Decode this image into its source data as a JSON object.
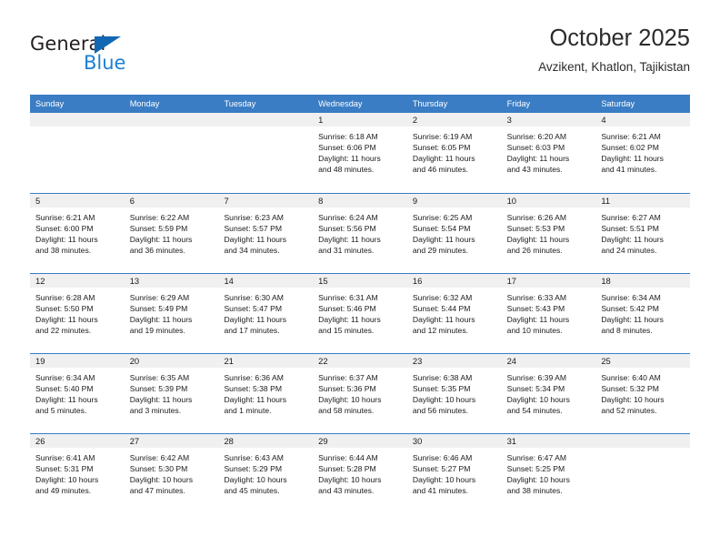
{
  "brand": {
    "name_part1": "General",
    "name_part2": "Blue",
    "triangle_color": "#1268b3",
    "blue_color": "#1d7fd4"
  },
  "header": {
    "title": "October 2025",
    "subtitle": "Avzikent, Khatlon, Tajikistan"
  },
  "theme": {
    "header_blue": "#3b7dc4",
    "day_strip_gray": "#f0f0f0",
    "text_color": "#1a1a1a"
  },
  "weekdays": [
    "Sunday",
    "Monday",
    "Tuesday",
    "Wednesday",
    "Thursday",
    "Friday",
    "Saturday"
  ],
  "weeks": [
    [
      {
        "day": "",
        "empty": true
      },
      {
        "day": "",
        "empty": true
      },
      {
        "day": "",
        "empty": true
      },
      {
        "day": "1",
        "sunrise": "Sunrise: 6:18 AM",
        "sunset": "Sunset: 6:06 PM",
        "daylight1": "Daylight: 11 hours",
        "daylight2": "and 48 minutes."
      },
      {
        "day": "2",
        "sunrise": "Sunrise: 6:19 AM",
        "sunset": "Sunset: 6:05 PM",
        "daylight1": "Daylight: 11 hours",
        "daylight2": "and 46 minutes."
      },
      {
        "day": "3",
        "sunrise": "Sunrise: 6:20 AM",
        "sunset": "Sunset: 6:03 PM",
        "daylight1": "Daylight: 11 hours",
        "daylight2": "and 43 minutes."
      },
      {
        "day": "4",
        "sunrise": "Sunrise: 6:21 AM",
        "sunset": "Sunset: 6:02 PM",
        "daylight1": "Daylight: 11 hours",
        "daylight2": "and 41 minutes."
      }
    ],
    [
      {
        "day": "5",
        "sunrise": "Sunrise: 6:21 AM",
        "sunset": "Sunset: 6:00 PM",
        "daylight1": "Daylight: 11 hours",
        "daylight2": "and 38 minutes."
      },
      {
        "day": "6",
        "sunrise": "Sunrise: 6:22 AM",
        "sunset": "Sunset: 5:59 PM",
        "daylight1": "Daylight: 11 hours",
        "daylight2": "and 36 minutes."
      },
      {
        "day": "7",
        "sunrise": "Sunrise: 6:23 AM",
        "sunset": "Sunset: 5:57 PM",
        "daylight1": "Daylight: 11 hours",
        "daylight2": "and 34 minutes."
      },
      {
        "day": "8",
        "sunrise": "Sunrise: 6:24 AM",
        "sunset": "Sunset: 5:56 PM",
        "daylight1": "Daylight: 11 hours",
        "daylight2": "and 31 minutes."
      },
      {
        "day": "9",
        "sunrise": "Sunrise: 6:25 AM",
        "sunset": "Sunset: 5:54 PM",
        "daylight1": "Daylight: 11 hours",
        "daylight2": "and 29 minutes."
      },
      {
        "day": "10",
        "sunrise": "Sunrise: 6:26 AM",
        "sunset": "Sunset: 5:53 PM",
        "daylight1": "Daylight: 11 hours",
        "daylight2": "and 26 minutes."
      },
      {
        "day": "11",
        "sunrise": "Sunrise: 6:27 AM",
        "sunset": "Sunset: 5:51 PM",
        "daylight1": "Daylight: 11 hours",
        "daylight2": "and 24 minutes."
      }
    ],
    [
      {
        "day": "12",
        "sunrise": "Sunrise: 6:28 AM",
        "sunset": "Sunset: 5:50 PM",
        "daylight1": "Daylight: 11 hours",
        "daylight2": "and 22 minutes."
      },
      {
        "day": "13",
        "sunrise": "Sunrise: 6:29 AM",
        "sunset": "Sunset: 5:49 PM",
        "daylight1": "Daylight: 11 hours",
        "daylight2": "and 19 minutes."
      },
      {
        "day": "14",
        "sunrise": "Sunrise: 6:30 AM",
        "sunset": "Sunset: 5:47 PM",
        "daylight1": "Daylight: 11 hours",
        "daylight2": "and 17 minutes."
      },
      {
        "day": "15",
        "sunrise": "Sunrise: 6:31 AM",
        "sunset": "Sunset: 5:46 PM",
        "daylight1": "Daylight: 11 hours",
        "daylight2": "and 15 minutes."
      },
      {
        "day": "16",
        "sunrise": "Sunrise: 6:32 AM",
        "sunset": "Sunset: 5:44 PM",
        "daylight1": "Daylight: 11 hours",
        "daylight2": "and 12 minutes."
      },
      {
        "day": "17",
        "sunrise": "Sunrise: 6:33 AM",
        "sunset": "Sunset: 5:43 PM",
        "daylight1": "Daylight: 11 hours",
        "daylight2": "and 10 minutes."
      },
      {
        "day": "18",
        "sunrise": "Sunrise: 6:34 AM",
        "sunset": "Sunset: 5:42 PM",
        "daylight1": "Daylight: 11 hours",
        "daylight2": "and 8 minutes."
      }
    ],
    [
      {
        "day": "19",
        "sunrise": "Sunrise: 6:34 AM",
        "sunset": "Sunset: 5:40 PM",
        "daylight1": "Daylight: 11 hours",
        "daylight2": "and 5 minutes."
      },
      {
        "day": "20",
        "sunrise": "Sunrise: 6:35 AM",
        "sunset": "Sunset: 5:39 PM",
        "daylight1": "Daylight: 11 hours",
        "daylight2": "and 3 minutes."
      },
      {
        "day": "21",
        "sunrise": "Sunrise: 6:36 AM",
        "sunset": "Sunset: 5:38 PM",
        "daylight1": "Daylight: 11 hours",
        "daylight2": "and 1 minute."
      },
      {
        "day": "22",
        "sunrise": "Sunrise: 6:37 AM",
        "sunset": "Sunset: 5:36 PM",
        "daylight1": "Daylight: 10 hours",
        "daylight2": "and 58 minutes."
      },
      {
        "day": "23",
        "sunrise": "Sunrise: 6:38 AM",
        "sunset": "Sunset: 5:35 PM",
        "daylight1": "Daylight: 10 hours",
        "daylight2": "and 56 minutes."
      },
      {
        "day": "24",
        "sunrise": "Sunrise: 6:39 AM",
        "sunset": "Sunset: 5:34 PM",
        "daylight1": "Daylight: 10 hours",
        "daylight2": "and 54 minutes."
      },
      {
        "day": "25",
        "sunrise": "Sunrise: 6:40 AM",
        "sunset": "Sunset: 5:32 PM",
        "daylight1": "Daylight: 10 hours",
        "daylight2": "and 52 minutes."
      }
    ],
    [
      {
        "day": "26",
        "sunrise": "Sunrise: 6:41 AM",
        "sunset": "Sunset: 5:31 PM",
        "daylight1": "Daylight: 10 hours",
        "daylight2": "and 49 minutes."
      },
      {
        "day": "27",
        "sunrise": "Sunrise: 6:42 AM",
        "sunset": "Sunset: 5:30 PM",
        "daylight1": "Daylight: 10 hours",
        "daylight2": "and 47 minutes."
      },
      {
        "day": "28",
        "sunrise": "Sunrise: 6:43 AM",
        "sunset": "Sunset: 5:29 PM",
        "daylight1": "Daylight: 10 hours",
        "daylight2": "and 45 minutes."
      },
      {
        "day": "29",
        "sunrise": "Sunrise: 6:44 AM",
        "sunset": "Sunset: 5:28 PM",
        "daylight1": "Daylight: 10 hours",
        "daylight2": "and 43 minutes."
      },
      {
        "day": "30",
        "sunrise": "Sunrise: 6:46 AM",
        "sunset": "Sunset: 5:27 PM",
        "daylight1": "Daylight: 10 hours",
        "daylight2": "and 41 minutes."
      },
      {
        "day": "31",
        "sunrise": "Sunrise: 6:47 AM",
        "sunset": "Sunset: 5:25 PM",
        "daylight1": "Daylight: 10 hours",
        "daylight2": "and 38 minutes."
      },
      {
        "day": "",
        "empty": true
      }
    ]
  ]
}
